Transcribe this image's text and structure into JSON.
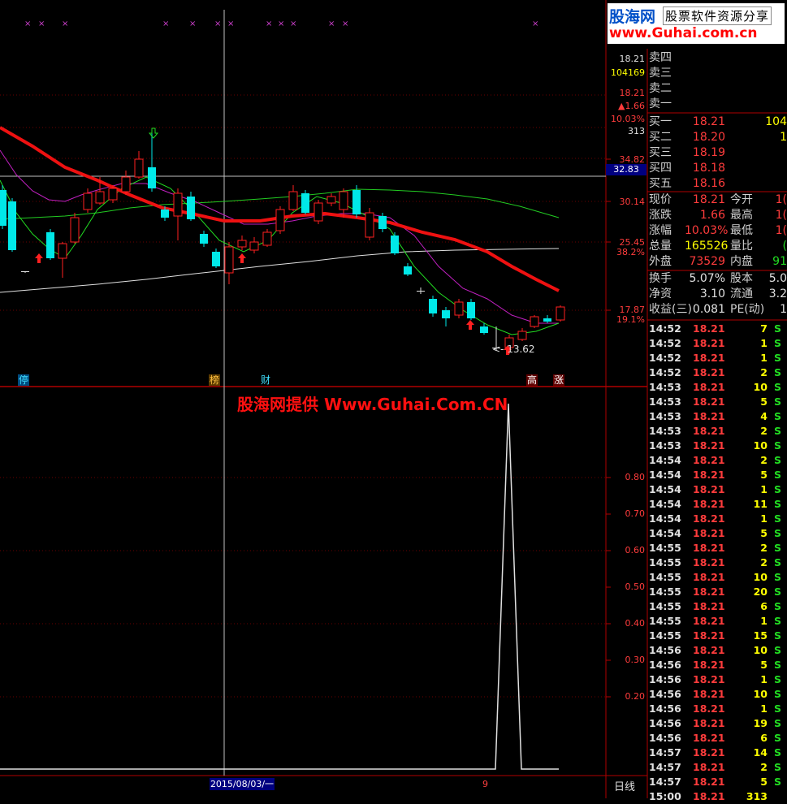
{
  "logo": {
    "brand": "股海网",
    "tagline": "股票软件资源分享",
    "url": "www.Guhai.com.cn"
  },
  "watermark": "股海网提供 Www.Guhai.Com.CN",
  "price_axis": {
    "top_block": [
      "18.21",
      "104169",
      "18.21",
      "▲1.66",
      "10.03%",
      "313"
    ],
    "ticks": [
      "34.82",
      "32.83",
      "30.14",
      "25.45",
      "38.2%",
      "17.87",
      "19.1%"
    ]
  },
  "indicator_axis": {
    "ticks": [
      "0.80",
      "0.70",
      "0.60",
      "0.50",
      "0.40",
      "0.30",
      "0.20"
    ]
  },
  "main_chart": {
    "low_label": "13.62",
    "events": [
      "停",
      "榜",
      "财",
      "高",
      "涨"
    ]
  },
  "footer": {
    "date": "2015/08/03/一",
    "marker": "9",
    "period": "日线"
  },
  "order_book": {
    "sell": [
      {
        "label": "卖四"
      },
      {
        "label": "卖三"
      },
      {
        "label": "卖二"
      },
      {
        "label": "卖一"
      }
    ],
    "buy": [
      {
        "label": "买一",
        "price": "18.21",
        "vol": "104"
      },
      {
        "label": "买二",
        "price": "18.20",
        "vol": "1"
      },
      {
        "label": "买三",
        "price": "18.19",
        "vol": ""
      },
      {
        "label": "买四",
        "price": "18.18",
        "vol": ""
      },
      {
        "label": "买五",
        "price": "18.16",
        "vol": ""
      }
    ]
  },
  "quote": [
    {
      "l1": "现价",
      "v1": "18.21",
      "c1": "red",
      "l2": "今开",
      "v2": "1(",
      "c2": "red"
    },
    {
      "l1": "涨跌",
      "v1": "1.66",
      "c1": "red",
      "l2": "最高",
      "v2": "1(",
      "c2": "red"
    },
    {
      "l1": "涨幅",
      "v1": "10.03%",
      "c1": "red",
      "l2": "最低",
      "v2": "1(",
      "c2": "red"
    },
    {
      "l1": "总量",
      "v1": "165526",
      "c1": "yel",
      "l2": "量比",
      "v2": "(",
      "c2": "grn"
    },
    {
      "l1": "外盘",
      "v1": "73529",
      "c1": "red",
      "l2": "内盘",
      "v2": "91",
      "c2": "grn"
    },
    {
      "l1": "换手",
      "v1": "5.07%",
      "c1": "wht",
      "l2": "股本",
      "v2": "5.0",
      "c2": "wht"
    },
    {
      "l1": "净资",
      "v1": "3.10",
      "c1": "wht",
      "l2": "流通",
      "v2": "3.2",
      "c2": "wht"
    },
    {
      "l1": "收益(三)",
      "v1": "0.081",
      "c1": "wht",
      "l2": "PE(动)",
      "v2": "1",
      "c2": "wht"
    }
  ],
  "ticks": [
    {
      "t": "14:52",
      "p": "18.21",
      "v": "7",
      "s": "S"
    },
    {
      "t": "14:52",
      "p": "18.21",
      "v": "1",
      "s": "S"
    },
    {
      "t": "14:52",
      "p": "18.21",
      "v": "1",
      "s": "S"
    },
    {
      "t": "14:52",
      "p": "18.21",
      "v": "2",
      "s": "S"
    },
    {
      "t": "14:53",
      "p": "18.21",
      "v": "10",
      "s": "S"
    },
    {
      "t": "14:53",
      "p": "18.21",
      "v": "5",
      "s": "S"
    },
    {
      "t": "14:53",
      "p": "18.21",
      "v": "4",
      "s": "S"
    },
    {
      "t": "14:53",
      "p": "18.21",
      "v": "2",
      "s": "S"
    },
    {
      "t": "14:53",
      "p": "18.21",
      "v": "10",
      "s": "S"
    },
    {
      "t": "14:54",
      "p": "18.21",
      "v": "2",
      "s": "S"
    },
    {
      "t": "14:54",
      "p": "18.21",
      "v": "5",
      "s": "S"
    },
    {
      "t": "14:54",
      "p": "18.21",
      "v": "1",
      "s": "S"
    },
    {
      "t": "14:54",
      "p": "18.21",
      "v": "11",
      "s": "S"
    },
    {
      "t": "14:54",
      "p": "18.21",
      "v": "1",
      "s": "S"
    },
    {
      "t": "14:54",
      "p": "18.21",
      "v": "5",
      "s": "S"
    },
    {
      "t": "14:55",
      "p": "18.21",
      "v": "2",
      "s": "S"
    },
    {
      "t": "14:55",
      "p": "18.21",
      "v": "2",
      "s": "S"
    },
    {
      "t": "14:55",
      "p": "18.21",
      "v": "10",
      "s": "S"
    },
    {
      "t": "14:55",
      "p": "18.21",
      "v": "20",
      "s": "S"
    },
    {
      "t": "14:55",
      "p": "18.21",
      "v": "6",
      "s": "S"
    },
    {
      "t": "14:55",
      "p": "18.21",
      "v": "1",
      "s": "S"
    },
    {
      "t": "14:55",
      "p": "18.21",
      "v": "15",
      "s": "S"
    },
    {
      "t": "14:56",
      "p": "18.21",
      "v": "10",
      "s": "S"
    },
    {
      "t": "14:56",
      "p": "18.21",
      "v": "5",
      "s": "S"
    },
    {
      "t": "14:56",
      "p": "18.21",
      "v": "1",
      "s": "S"
    },
    {
      "t": "14:56",
      "p": "18.21",
      "v": "10",
      "s": "S"
    },
    {
      "t": "14:56",
      "p": "18.21",
      "v": "1",
      "s": "S"
    },
    {
      "t": "14:56",
      "p": "18.21",
      "v": "19",
      "s": "S"
    },
    {
      "t": "14:56",
      "p": "18.21",
      "v": "6",
      "s": "S"
    },
    {
      "t": "14:57",
      "p": "18.21",
      "v": "14",
      "s": "S"
    },
    {
      "t": "14:57",
      "p": "18.21",
      "v": "2",
      "s": "S"
    },
    {
      "t": "14:57",
      "p": "18.21",
      "v": "5",
      "s": "S"
    },
    {
      "t": "15:00",
      "p": "18.21",
      "v": "313",
      "s": ""
    }
  ]
}
